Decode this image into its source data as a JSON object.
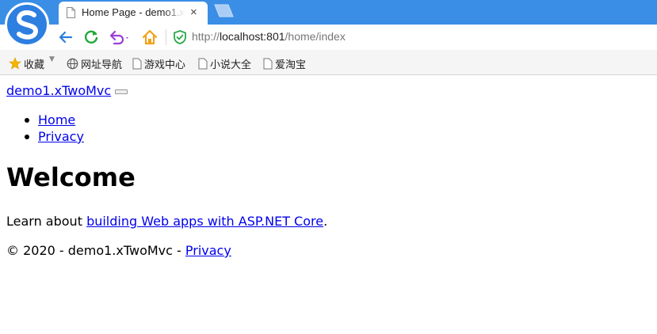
{
  "browser": {
    "tab_title": "Home Page - demo1.xTwoMvc",
    "tab_close": "×",
    "url_scheme": "http://",
    "url_host": "localhost:801",
    "url_path": "/home/index",
    "accent": "#3a8ee6"
  },
  "bookmarks": [
    {
      "label": "收藏",
      "icon": "star-icon"
    },
    {
      "label": "网址导航",
      "icon": "globe-icon"
    },
    {
      "label": "游戏中心",
      "icon": "page-icon"
    },
    {
      "label": "小说大全",
      "icon": "page-icon"
    },
    {
      "label": "爱淘宝",
      "icon": "page-icon"
    }
  ],
  "page": {
    "brand": "demo1.xTwoMvc",
    "nav": [
      "Home",
      "Privacy"
    ],
    "heading": "Welcome",
    "lead_prefix": "Learn about ",
    "lead_link": "building Web apps with ASP.NET Core",
    "lead_suffix": ".",
    "footer_prefix": "© 2020 - demo1.xTwoMvc - ",
    "footer_link": "Privacy",
    "link_color": "#0000ee"
  }
}
